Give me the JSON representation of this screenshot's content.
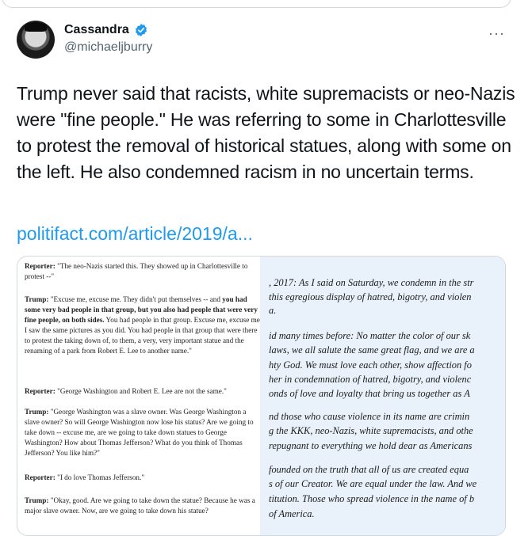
{
  "tweet": {
    "display_name": "Cassandra",
    "handle": "@michaeljburry",
    "more_label": "···",
    "text": "Trump never said that racists, white supremacists or neo-Nazis were \"fine people.\" He was referring to some in Charlottesville to protest the removal of historical statues, along with some on the left. He also condemned racism in no uncertain terms.",
    "link": "politifact.com/article/2019/a..."
  },
  "media": {
    "transcript": [
      {
        "speaker": "Reporter:",
        "before": " \"The neo-Nazis started this. They showed up in Charlottesville to protest --\"",
        "bold": "",
        "after": ""
      },
      {
        "speaker": "Trump:",
        "before": " \"Excuse me, excuse me. They didn't put themselves -- and ",
        "bold": "you had some very bad people in that group, but you also had people that were very fine people, on both sides.",
        "after": " You had people in that group. Excuse me, excuse me. I saw the same pictures as you did. You had people in that group that were there to protest the taking down of, to them, a very, very important statue and the renaming of a park from Robert E. Lee to another name.\""
      },
      {
        "speaker": "Reporter:",
        "before": " \"George Washington and Robert E. Lee are not the same.\"",
        "bold": "",
        "after": ""
      },
      {
        "speaker": "Trump:",
        "before": " \"George Washington was a slave owner. Was George Washington a slave owner? So will George Washington now lose his status? Are we going to take down -- excuse me, are we going to take down statues to George Washington? How about Thomas Jefferson? What do you think of Thomas Jefferson? You like him?\"",
        "bold": "",
        "after": ""
      },
      {
        "speaker": "Reporter:",
        "before": " \"I do love Thomas Jefferson.\"",
        "bold": "",
        "after": ""
      },
      {
        "speaker": "Trump:",
        "before": " \"Okay, good. Are we going to take down the statue? Because he was a major slave owner. Now, are we going to take down his statue?",
        "bold": "",
        "after": ""
      }
    ],
    "statement_lines": [
      ", 2017: As I said on Saturday, we condemn in the str",
      "this egregious display of hatred, bigotry, and violen",
      "a.",
      "id many times before: No matter the color of our sk",
      "laws, we all salute the same great flag, and we are a",
      "hty God. We must love each other, show affection fo",
      "her in condemnation of hatred, bigotry, and violenc",
      "onds of love and loyalty that bring us together as A",
      "nd those who cause violence in its name are crimin",
      "g the KKK, neo-Nazis, white supremacists, and othe",
      "repugnant to everything we hold dear as Americans",
      "founded on the truth that all of us are created equa",
      "s of our Creator. We are equal under the law. And we",
      "titution. Those who spread violence in the name of b",
      "of America."
    ]
  }
}
